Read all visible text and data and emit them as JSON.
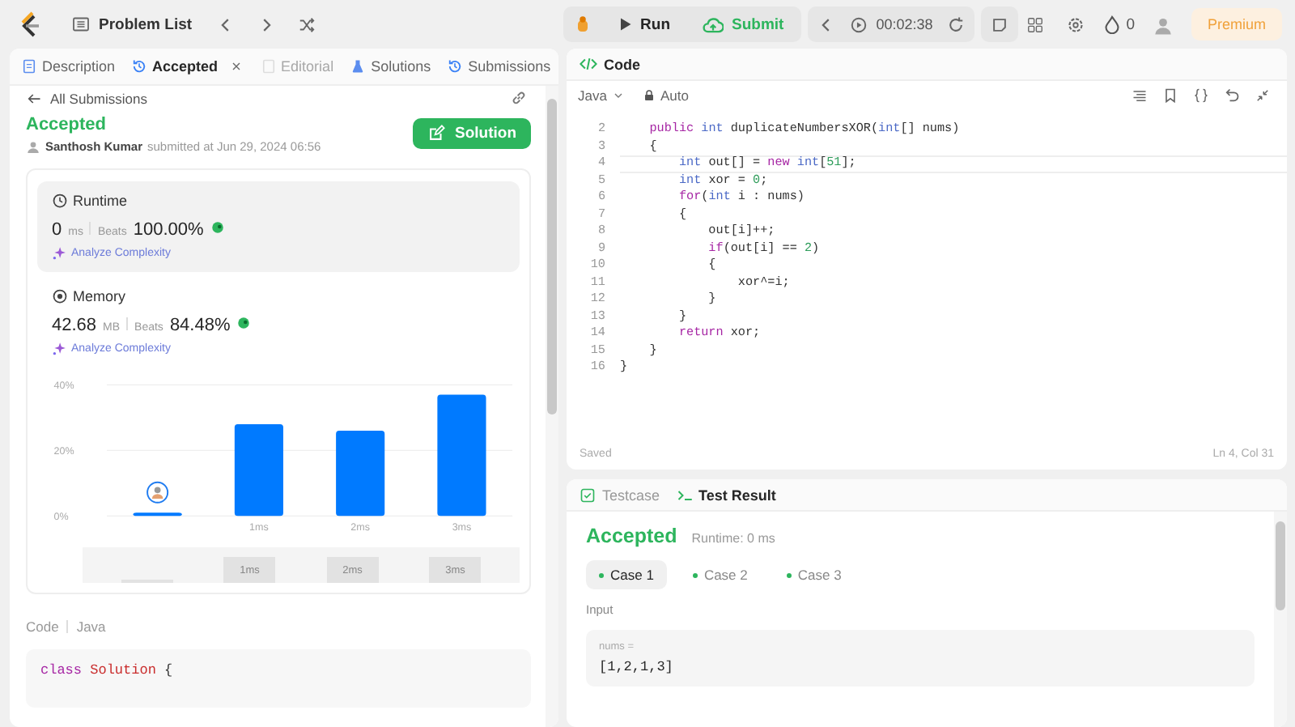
{
  "topbar": {
    "problem_list": "Problem List",
    "run": "Run",
    "submit": "Submit",
    "timer": "00:02:38",
    "streak": "0",
    "premium": "Premium"
  },
  "left_tabs": [
    {
      "label": "Description",
      "selected": false,
      "disabled": false,
      "kind": "description"
    },
    {
      "label": "Accepted",
      "selected": true,
      "disabled": false,
      "kind": "result",
      "closable": true
    },
    {
      "label": "Editorial",
      "selected": false,
      "disabled": true,
      "kind": "editorial"
    },
    {
      "label": "Solutions",
      "selected": false,
      "disabled": false,
      "kind": "solutions"
    },
    {
      "label": "Submissions",
      "selected": false,
      "disabled": false,
      "kind": "submissions"
    }
  ],
  "back_link": "All Submissions",
  "submission": {
    "status": "Accepted",
    "author": "Santhosh Kumar",
    "submitted": "submitted at Jun 29, 2024 06:56",
    "solution_button": "Solution"
  },
  "metrics": [
    {
      "kind": "runtime",
      "title": "Runtime",
      "value": "0",
      "unit": "ms",
      "beats_label": "Beats",
      "beats": "100.00%",
      "analyze": "Analyze Complexity",
      "selected": true
    },
    {
      "kind": "memory",
      "title": "Memory",
      "value": "42.68",
      "unit": "MB",
      "beats_label": "Beats",
      "beats": "84.48%",
      "analyze": "Analyze Complexity",
      "selected": false
    }
  ],
  "chart_data": {
    "type": "bar",
    "categories": [
      null,
      "1ms",
      "2ms",
      "3ms"
    ],
    "series": [
      {
        "color": "#007aff",
        "values": [
          1,
          28,
          26,
          37
        ]
      }
    ],
    "ylim": [
      0,
      40
    ],
    "yticks": [
      {
        "value": 0,
        "label": "0%"
      },
      {
        "value": 20,
        "label": "20%"
      },
      {
        "value": 40,
        "label": "40%"
      }
    ]
  },
  "brush_labels": [
    "1ms",
    "2ms",
    "3ms"
  ],
  "code_heading": {
    "label": "Code",
    "language": "Java"
  },
  "code_preview": [
    [
      {
        "text": "class",
        "kind": "keyword"
      },
      {
        "text": " Solution",
        "kind": "class"
      },
      {
        "text": " {",
        "kind": "plain"
      }
    ]
  ],
  "editor": {
    "title": "Code",
    "language": "Java",
    "mode": "Auto",
    "status": "Saved",
    "cursor": "Ln 4, Col 31",
    "lines": [
      {
        "no": "2",
        "current": false,
        "tokens": [
          {
            "text": "    public",
            "kind": "keyword"
          },
          {
            "text": " int",
            "kind": "type"
          },
          {
            "text": " duplicateNumbersXOR(",
            "kind": "plain"
          },
          {
            "text": "int",
            "kind": "type"
          },
          {
            "text": "[] nums)",
            "kind": "plain"
          }
        ]
      },
      {
        "no": "3",
        "current": false,
        "tokens": [
          {
            "text": "    {",
            "kind": "plain"
          }
        ]
      },
      {
        "no": "4",
        "current": true,
        "tokens": [
          {
            "text": "        int",
            "kind": "type"
          },
          {
            "text": " out[] = ",
            "kind": "plain"
          },
          {
            "text": "new",
            "kind": "keyword"
          },
          {
            "text": " int",
            "kind": "type"
          },
          {
            "text": "[",
            "kind": "plain"
          },
          {
            "text": "51",
            "kind": "number"
          },
          {
            "text": "];",
            "kind": "plain"
          }
        ]
      },
      {
        "no": "5",
        "current": false,
        "tokens": [
          {
            "text": "        int",
            "kind": "type"
          },
          {
            "text": " xor = ",
            "kind": "plain"
          },
          {
            "text": "0",
            "kind": "number"
          },
          {
            "text": ";",
            "kind": "plain"
          }
        ]
      },
      {
        "no": "6",
        "current": false,
        "tokens": [
          {
            "text": "        for",
            "kind": "keyword"
          },
          {
            "text": "(",
            "kind": "plain"
          },
          {
            "text": "int",
            "kind": "type"
          },
          {
            "text": " i : nums)",
            "kind": "plain"
          }
        ]
      },
      {
        "no": "7",
        "current": false,
        "tokens": [
          {
            "text": "        {",
            "kind": "plain"
          }
        ]
      },
      {
        "no": "8",
        "current": false,
        "tokens": [
          {
            "text": "            out[i]++;",
            "kind": "plain"
          }
        ]
      },
      {
        "no": "9",
        "current": false,
        "tokens": [
          {
            "text": "            if",
            "kind": "keyword"
          },
          {
            "text": "(out[i] == ",
            "kind": "plain"
          },
          {
            "text": "2",
            "kind": "number"
          },
          {
            "text": ")",
            "kind": "plain"
          }
        ]
      },
      {
        "no": "10",
        "current": false,
        "tokens": [
          {
            "text": "            {",
            "kind": "plain"
          }
        ]
      },
      {
        "no": "11",
        "current": false,
        "tokens": [
          {
            "text": "                xor^=i;",
            "kind": "plain"
          }
        ]
      },
      {
        "no": "12",
        "current": false,
        "tokens": [
          {
            "text": "            }",
            "kind": "plain"
          }
        ]
      },
      {
        "no": "13",
        "current": false,
        "tokens": [
          {
            "text": "        }",
            "kind": "plain"
          }
        ]
      },
      {
        "no": "14",
        "current": false,
        "tokens": [
          {
            "text": "        return",
            "kind": "keyword"
          },
          {
            "text": " xor;",
            "kind": "plain"
          }
        ]
      },
      {
        "no": "15",
        "current": false,
        "tokens": [
          {
            "text": "    }",
            "kind": "plain"
          }
        ]
      },
      {
        "no": "16",
        "current": false,
        "tokens": [
          {
            "text": "}",
            "kind": "plain"
          }
        ]
      }
    ]
  },
  "test_tabs": [
    {
      "label": "Testcase",
      "selected": false,
      "kind": "testcase"
    },
    {
      "label": "Test Result",
      "selected": true,
      "kind": "result"
    }
  ],
  "result": {
    "status": "Accepted",
    "runtime": "Runtime: 0 ms",
    "cases": [
      {
        "label": "Case 1",
        "selected": true
      },
      {
        "label": "Case 2",
        "selected": false
      },
      {
        "label": "Case 3",
        "selected": false
      }
    ],
    "input_label": "Input",
    "param": "nums =",
    "value": "[1,2,1,3]"
  }
}
